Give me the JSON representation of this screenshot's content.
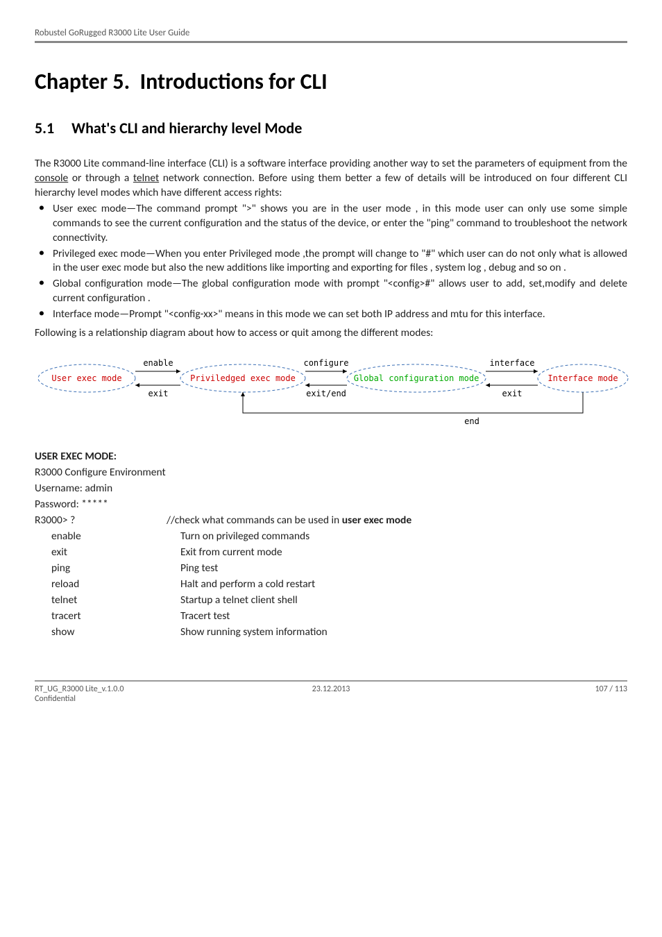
{
  "header": {
    "title": "Robustel GoRugged R3000 Lite User Guide"
  },
  "chapter": {
    "number": "Chapter 5.",
    "title": "Introductions for CLI"
  },
  "section": {
    "number": "5.1",
    "title": "What's CLI and hierarchy level Mode"
  },
  "intro_before_link1": "The R3000 Lite command-line interface (CLI) is a software interface providing another way to set the parameters of equipment from the ",
  "intro_link1": "console",
  "intro_mid": " or through a ",
  "intro_link2": "telnet",
  "intro_after_link2": " network connection. Before using them better a few of details will be introduced on four different CLI hierarchy level modes which have different access rights:",
  "bullets": [
    "User exec mode—The command prompt \">\" shows you are in the user mode , in this mode user can only use some simple commands to see the current configuration and the status of the device, or enter the \"ping\" command to troubleshoot the network connectivity.",
    "Privileged exec mode—When you enter Privileged mode ,the prompt will change to \"#\" which user can do not only what is allowed in the user exec mode but also the new additions like importing and exporting for files , system log , debug and so on .",
    "Global configuration mode—The global configuration mode with prompt \"<config>#\" allows user to add, set,modify and delete current configuration .",
    "Interface mode—Prompt \"<config-xx>\" means in this mode we can set both IP address and mtu for this interface."
  ],
  "following": "Following is a relationship diagram about how to access or quit among the different modes:",
  "chart_data": {
    "type": "diagram",
    "nodes": [
      {
        "id": "user",
        "label": "User exec mode",
        "color": "#c00"
      },
      {
        "id": "priv",
        "label": "Priviledged exec mode",
        "color": "#c00"
      },
      {
        "id": "global",
        "label": "Global configuration mode",
        "color": "#0a0"
      },
      {
        "id": "iface",
        "label": "Interface mode",
        "color": "#c00"
      }
    ],
    "edges": [
      {
        "from": "user",
        "to": "priv",
        "label": "enable",
        "dir": "forward"
      },
      {
        "from": "priv",
        "to": "user",
        "label": "exit",
        "dir": "forward"
      },
      {
        "from": "priv",
        "to": "global",
        "label": "configure",
        "dir": "forward"
      },
      {
        "from": "global",
        "to": "priv",
        "label": "exit/end",
        "dir": "forward"
      },
      {
        "from": "global",
        "to": "iface",
        "label": "interface",
        "dir": "forward"
      },
      {
        "from": "iface",
        "to": "global",
        "label": "exit",
        "dir": "forward"
      },
      {
        "from": "iface",
        "to": "priv",
        "label": "end",
        "dir": "forward"
      }
    ]
  },
  "user_exec": {
    "heading": "USER EXEC MODE:",
    "env": "R3000 Configure Environment",
    "username_line": "Username: admin",
    "password_line": "Password: *****",
    "prompt_cmd": "R3000> ?",
    "prompt_desc_prefix": "//check what commands can be used in ",
    "prompt_desc_bold": "user exec mode",
    "commands": [
      {
        "cmd": "enable",
        "desc": "Turn on privileged commands"
      },
      {
        "cmd": "exit",
        "desc": "Exit from current mode"
      },
      {
        "cmd": "ping",
        "desc": "Ping test"
      },
      {
        "cmd": "reload",
        "desc": "Halt and perform a cold restart"
      },
      {
        "cmd": "telnet",
        "desc": "Startup a telnet client shell"
      },
      {
        "cmd": "tracert",
        "desc": "Tracert test"
      },
      {
        "cmd": "show",
        "desc": "Show running system information"
      }
    ]
  },
  "footer": {
    "left": "RT_UG_R3000 Lite_v.1.0.0",
    "center": "23.12.2013",
    "right": "107 / 113",
    "confidential": "Confidential"
  }
}
